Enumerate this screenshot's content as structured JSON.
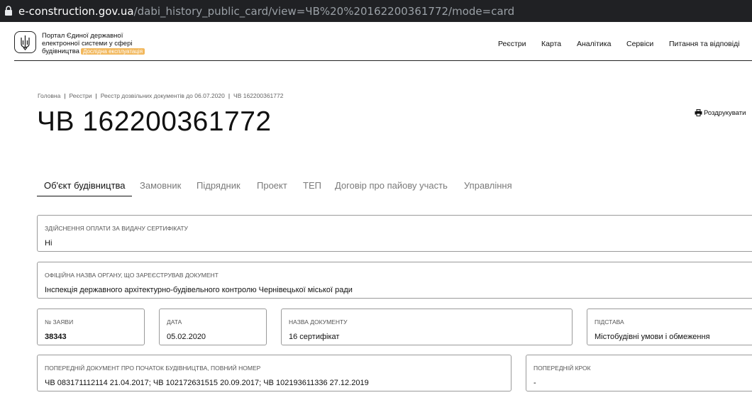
{
  "browser": {
    "url_domain": "e-construction.gov.ua",
    "url_path": "/dabi_history_public_card/view=ЧВ%20%20162200361772/mode=card"
  },
  "header": {
    "brand_line1": "Портал Єдиної державної",
    "brand_line2": "електронної системи у сфері",
    "brand_line3": "будівництва",
    "badge": "Дослідна експлуатація",
    "nav": [
      "Реєстри",
      "Карта",
      "Аналітика",
      "Сервіси",
      "Питання та відповіді"
    ]
  },
  "breadcrumb": [
    "Головна",
    "Реєстри",
    "Реєстр дозвільних документів до 06.07.2020",
    "ЧВ 162200361772"
  ],
  "page": {
    "title": "ЧВ 162200361772",
    "print_label": "Роздрукувати"
  },
  "tabs": [
    "Об'єкт будівництва",
    "Замовник",
    "Підрядник",
    "Проект",
    "ТЕП",
    "Договір про пайову участь",
    "Управління"
  ],
  "fields": {
    "payment": {
      "label": "Здійснення оплати за видачу сертифікату",
      "value": "Ні"
    },
    "authority": {
      "label": "Офіційна назва органу, що зареєстрував документ",
      "value": "Інспекція державного архітектурно-будівельного контролю Чернівецької міської ради"
    },
    "app_no": {
      "label": "№ заяви",
      "value": "38343"
    },
    "date": {
      "label": "Дата",
      "value": "05.02.2020"
    },
    "doc_name": {
      "label": "Назва документу",
      "value": "16 сертифікат"
    },
    "basis": {
      "label": "Підстава",
      "value": "Містобудівні умови і обмеження"
    },
    "prev_doc": {
      "label": "Попередній документ про початок будівництва, повний номер",
      "value": "ЧВ 083171112114 21.04.2017; ЧВ 102172631515 20.09.2017; ЧВ 102193611336 27.12.2019"
    },
    "prev_step": {
      "label": "Попередній крок",
      "value": "-"
    }
  },
  "colors": {
    "badge": "#f2b85d",
    "urlbar": "#202124"
  }
}
